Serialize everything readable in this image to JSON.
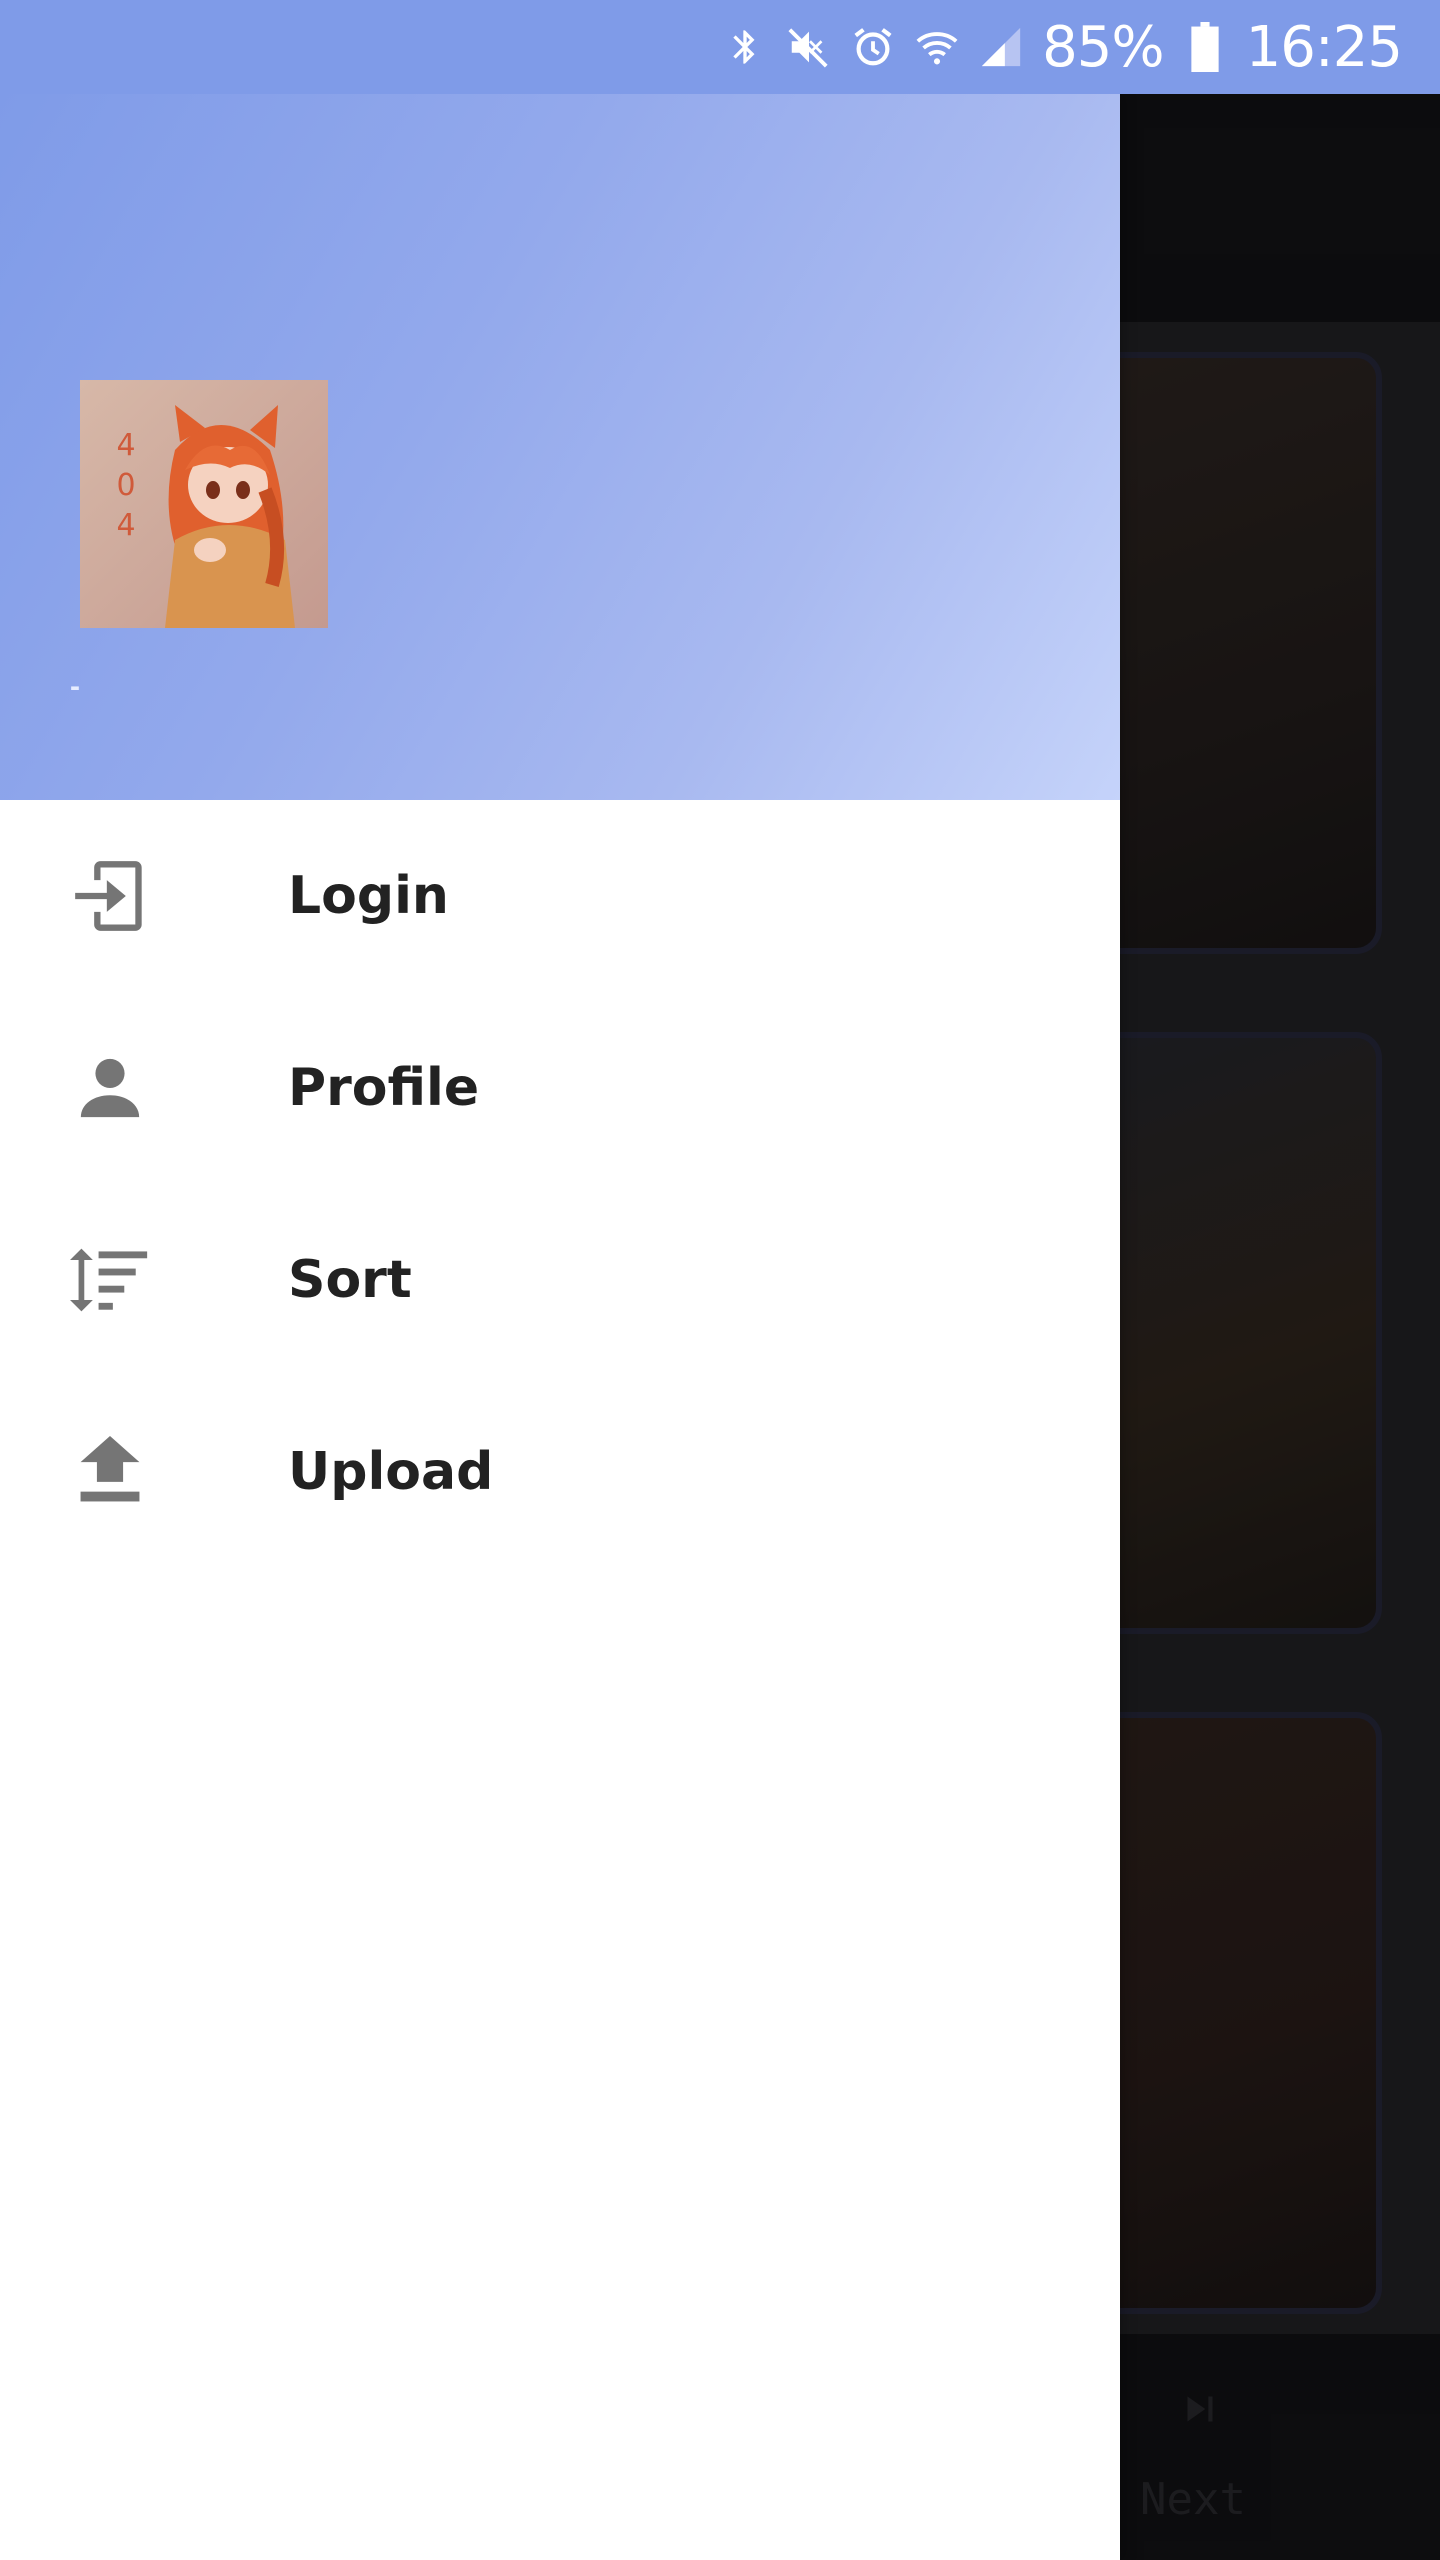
{
  "status_bar": {
    "battery": "85%",
    "time": "16:25",
    "icons": [
      "bluetooth-icon",
      "mute-icon",
      "alarm-icon",
      "wifi-icon",
      "signal-icon",
      "battery-icon"
    ]
  },
  "drawer": {
    "header": {
      "avatar_text": [
        "4",
        "0",
        "4"
      ],
      "username": "-"
    },
    "menu": [
      {
        "label": "Login",
        "icon": "login-icon"
      },
      {
        "label": "Profile",
        "icon": "person-icon"
      },
      {
        "label": "Sort",
        "icon": "sort-icon"
      },
      {
        "label": "Upload",
        "icon": "upload-icon"
      }
    ]
  },
  "background": {
    "next_label": "Next"
  },
  "colors": {
    "header_start": "#7f9be8",
    "header_end": "#c5d3fa",
    "menu_icon": "#757575",
    "menu_text": "#222222"
  }
}
